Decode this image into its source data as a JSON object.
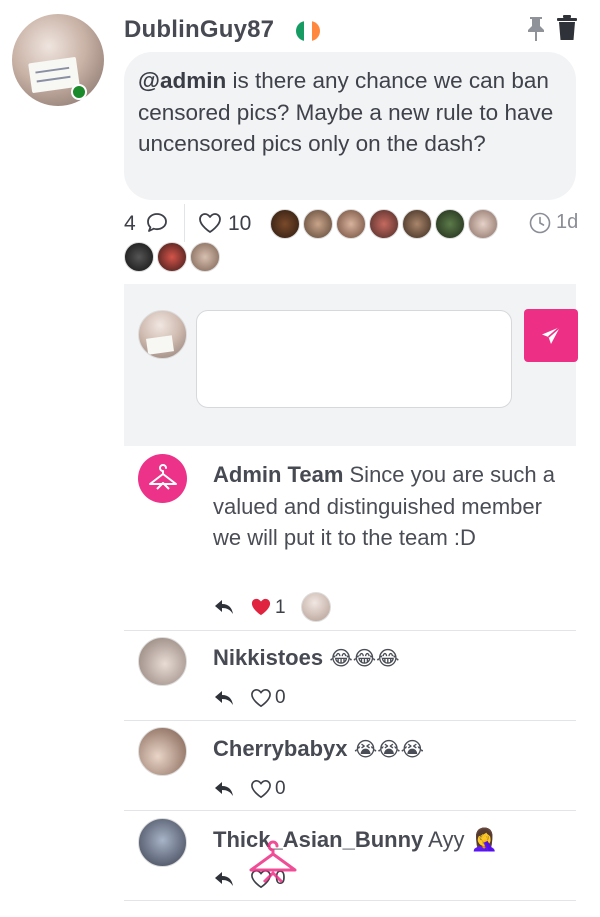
{
  "post": {
    "username": "DublinGuy87",
    "flag_colors": [
      "#169b62",
      "#ffffff",
      "#ff883e"
    ],
    "mention": "@admin",
    "body": " is there any chance we can ban censored pics? Maybe a new rule to have uncensored pics only on the dash?",
    "comment_count": "4",
    "like_count": "10",
    "time": "1d"
  },
  "likers": [
    "liker-1",
    "liker-2",
    "liker-3",
    "liker-4",
    "liker-5",
    "liker-6",
    "liker-7",
    "liker-8",
    "liker-9",
    "liker-10"
  ],
  "reply_box": {
    "value": ""
  },
  "comments": [
    {
      "author": "Admin Team",
      "text": " Since you are such a valued and distinguished member we will put it to the team :D",
      "likes": "1",
      "liked": true
    },
    {
      "author": "Nikkistoes",
      "text": " 😂😂😂",
      "likes": "0",
      "liked": false
    },
    {
      "author": "Cherrybabyx",
      "text": " 😭😭😭",
      "likes": "0",
      "liked": false
    },
    {
      "author": "Thick_Asian_Bunny",
      "text": " Ayy 🤦‍♀️",
      "likes": "0",
      "liked": false
    }
  ],
  "colors": {
    "accent": "#ee2f86",
    "online": "#1a8a2a",
    "liked_heart": "#e0243f"
  },
  "icons": [
    "pin-icon",
    "trash-icon",
    "comment-icon",
    "heart-icon",
    "clock-icon",
    "send-icon",
    "reply-icon",
    "hanger-logo-icon"
  ]
}
